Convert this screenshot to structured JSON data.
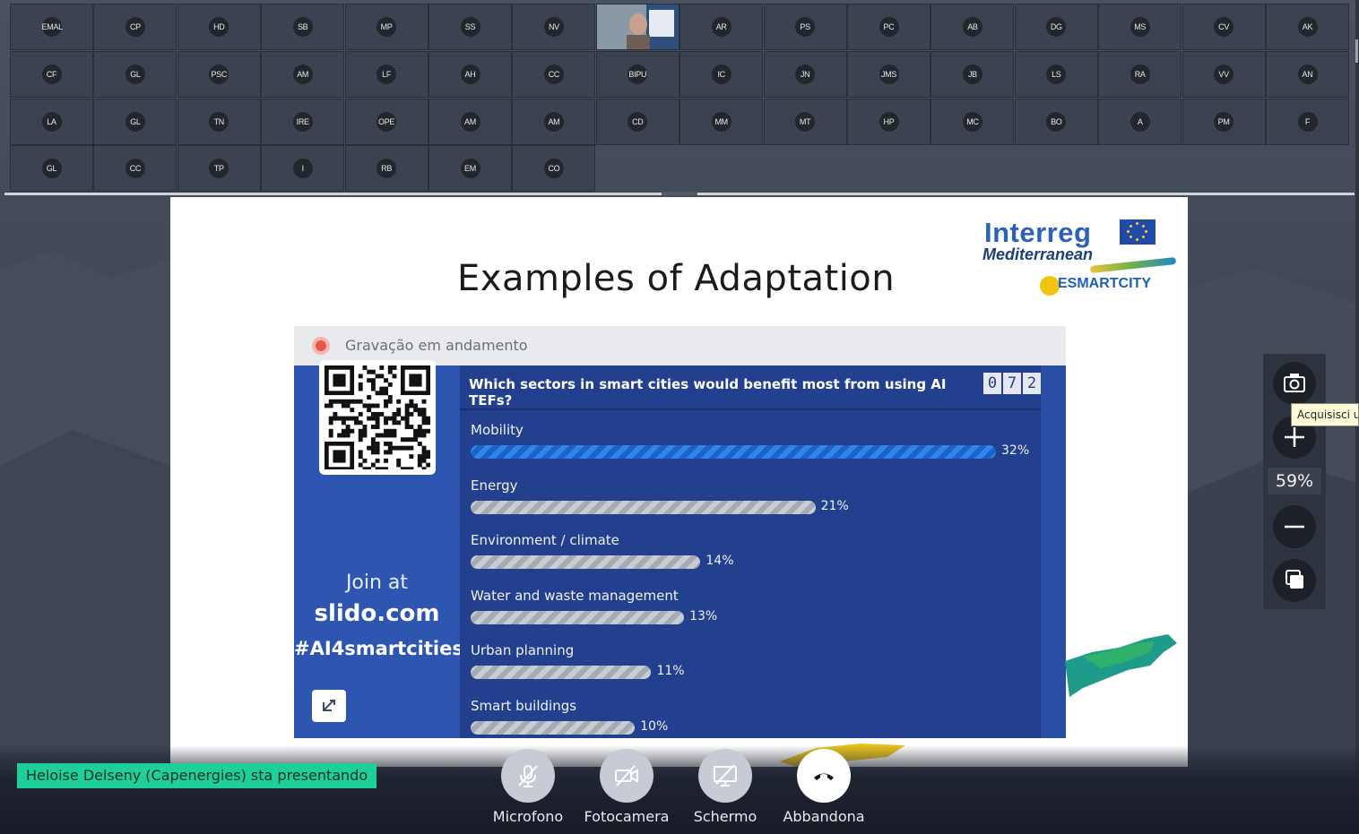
{
  "participants": [
    "EMAL",
    "CP",
    "HD",
    "SB",
    "MP",
    "SS",
    "NV",
    "",
    "AR",
    "PS",
    "PC",
    "AB",
    "DG",
    "MS",
    "CV",
    "AK",
    "CF",
    "GL",
    "PSC",
    "AM",
    "LF",
    "AH",
    "CC",
    "BIPU",
    "IC",
    "JN",
    "JMS",
    "JB",
    "LS",
    "RA",
    "VV",
    "AN",
    "LA",
    "GL",
    "TN",
    "IRE",
    "OPE",
    "AM",
    "AM",
    "CD",
    "MM",
    "MT",
    "HP",
    "MC",
    "BO",
    "A",
    "PM",
    "F",
    "GL",
    "CC",
    "TP",
    "I",
    "RB",
    "EM",
    "CO"
  ],
  "slide": {
    "title": "Examples of Adaptation",
    "logo_brand": "Interreg",
    "logo_sub": "Mediterranean",
    "logo_project": "ESMARTCITY"
  },
  "slido": {
    "recording_text": "Gravação em andamento",
    "join_line1": "Join at",
    "join_line2": "slido.com",
    "join_line3": "#AI4smartcities",
    "question": "Which sectors in smart cities would benefit most from using AI TEFs?",
    "counter": [
      "0",
      "7",
      "2"
    ]
  },
  "chart_data": {
    "type": "bar",
    "title": "Which sectors in smart cities would benefit most from using AI TEFs?",
    "categories": [
      "Mobility",
      "Energy",
      "Environment / climate",
      "Water and waste management",
      "Urban planning",
      "Smart buildings"
    ],
    "values": [
      32,
      21,
      14,
      13,
      11,
      10
    ],
    "labels": [
      "32%",
      "21%",
      "14%",
      "13%",
      "11%",
      "10%"
    ],
    "highlight_color": "#2f86e6",
    "bar_color": "#c9ccd2"
  },
  "zoom": {
    "level": "59%",
    "tooltip": "Acquisisci u"
  },
  "presenter_banner": "Heloise Delseny (Capenergies) sta presentando",
  "controls": {
    "mic_label": "Microfono",
    "camera_label": "Fotocamera",
    "screen_label": "Schermo",
    "leave_label": "Abbandona"
  },
  "colors": {
    "presenter_green": "#1fcf9a",
    "slido_blue": "#23408f"
  }
}
